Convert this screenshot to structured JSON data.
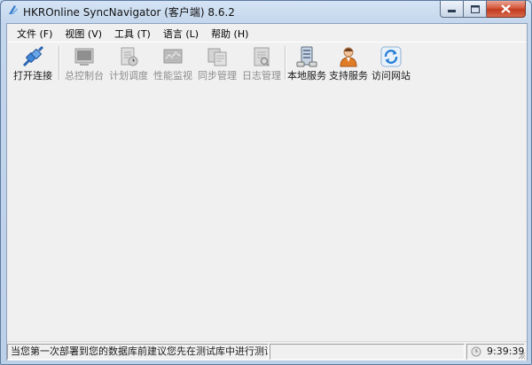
{
  "window": {
    "title": "HKROnline SyncNavigator (客户端) 8.6.2"
  },
  "menu": [
    {
      "label": "文件 (F)"
    },
    {
      "label": "视图 (V)"
    },
    {
      "label": "工具 (T)"
    },
    {
      "label": "语言 (L)"
    },
    {
      "label": "帮助 (H)"
    }
  ],
  "toolbar": {
    "connect": {
      "label": "打开连接",
      "icon": "connect-plug-icon",
      "enabled": true
    },
    "console": {
      "label": "总控制台",
      "icon": "console-icon",
      "enabled": false
    },
    "schedule": {
      "label": "计划调度",
      "icon": "schedule-icon",
      "enabled": false
    },
    "monitor": {
      "label": "性能监视",
      "icon": "monitor-icon",
      "enabled": false
    },
    "sync": {
      "label": "同步管理",
      "icon": "sync-manage-icon",
      "enabled": false
    },
    "log": {
      "label": "日志管理",
      "icon": "log-icon",
      "enabled": false
    },
    "local_service": {
      "label": "本地服务",
      "icon": "server-icon",
      "enabled": true
    },
    "support": {
      "label": "支持服务",
      "icon": "support-person-icon",
      "enabled": true
    },
    "website": {
      "label": "访问网站",
      "icon": "refresh-web-icon",
      "enabled": true
    }
  },
  "status": {
    "message": "当您第一次部署到您的数据库前建议您先在测试库中进行测试。",
    "time": "9:39:39"
  },
  "colors": {
    "title_gradient_top": "#d5e4f5",
    "close_button": "#c33a1e",
    "disabled_text": "#8d8d8d"
  }
}
